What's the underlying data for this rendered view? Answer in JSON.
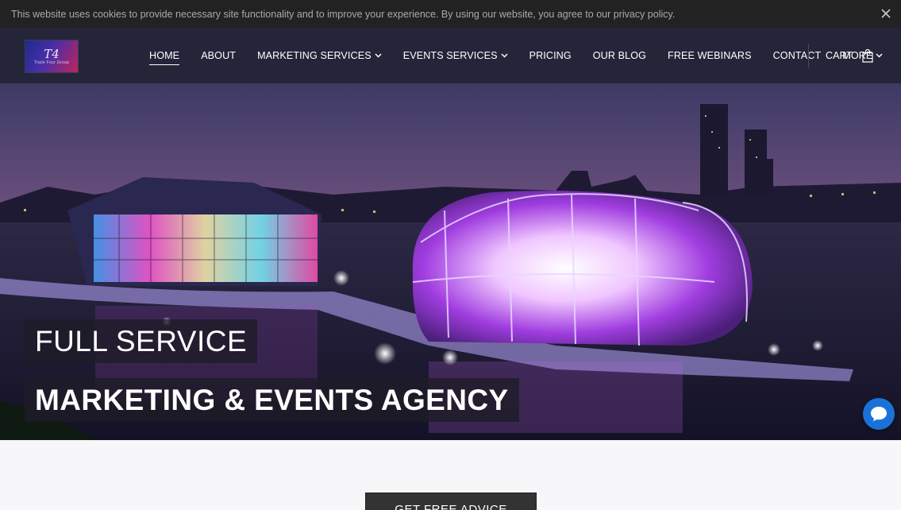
{
  "cookie_bar": {
    "text": "This website uses cookies to provide necessary site functionality and to improve your experience. By using our website, you agree to our privacy policy."
  },
  "header": {
    "logo": {
      "monogram": "T4",
      "tagline": "Triple Four Group"
    },
    "nav": [
      {
        "label": "HOME",
        "active": true,
        "dropdown": false
      },
      {
        "label": "ABOUT",
        "active": false,
        "dropdown": false
      },
      {
        "label": "MARKETING SERVICES",
        "active": false,
        "dropdown": true
      },
      {
        "label": "EVENTS SERVICES",
        "active": false,
        "dropdown": true
      },
      {
        "label": "PRICING",
        "active": false,
        "dropdown": false
      },
      {
        "label": "OUR BLOG",
        "active": false,
        "dropdown": false
      },
      {
        "label": "FREE WEBINARS",
        "active": false,
        "dropdown": false
      },
      {
        "label": "CONTACT",
        "active": false,
        "dropdown": false
      },
      {
        "label": "MORE",
        "active": false,
        "dropdown": true
      }
    ],
    "cart_label": "CART"
  },
  "hero": {
    "line1": "FULL SERVICE",
    "line2": "MARKETING & EVENTS AGENCY"
  },
  "cta": {
    "label": "GET FREE ADVICE"
  },
  "icons": {
    "close": "close-icon",
    "chevron": "chevron-down-icon",
    "cart": "shopping-bag-icon",
    "chat": "chat-bubble-icon"
  },
  "colors": {
    "cookie_bg": "#222222",
    "header_bg": "#25253a",
    "chat_blue": "#1a72d9",
    "cta_bg": "#333333"
  }
}
